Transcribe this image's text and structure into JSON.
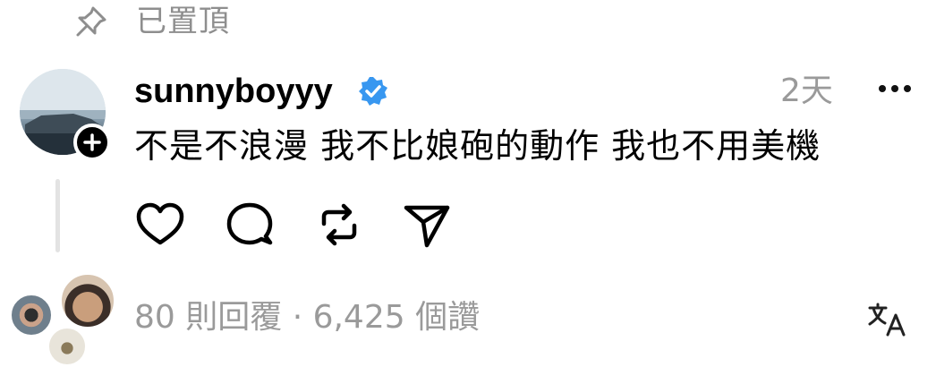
{
  "pinned": {
    "label": "已置頂",
    "icon": "pin-icon"
  },
  "post": {
    "username": "sunnyboyyy",
    "verified": true,
    "verified_color": "#3897f0",
    "timestamp": "2天",
    "text": "不是不浪漫 我不比娘砲的動作 我也不用美機"
  },
  "actions": [
    {
      "name": "like",
      "icon": "heart-icon"
    },
    {
      "name": "comment",
      "icon": "comment-icon"
    },
    {
      "name": "repost",
      "icon": "repost-icon"
    },
    {
      "name": "share",
      "icon": "send-icon"
    }
  ],
  "stats": {
    "text": "80 則回覆 · 6,425 個讚"
  },
  "colors": {
    "text": "#000000",
    "muted": "#9a9a9a",
    "thread_line": "#e3e3e3"
  }
}
